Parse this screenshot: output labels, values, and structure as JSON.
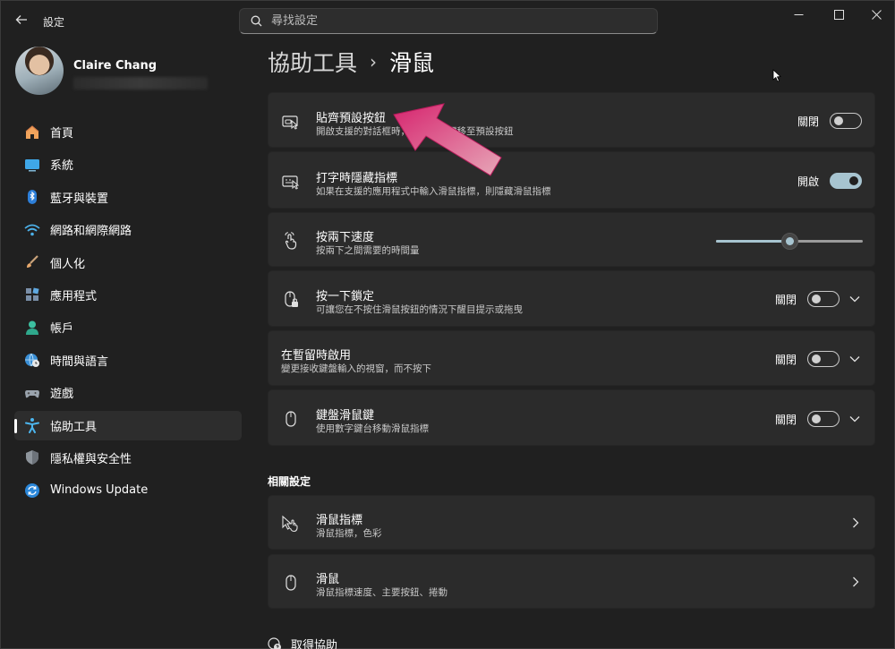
{
  "window": {
    "title": "設定"
  },
  "search": {
    "placeholder": "尋找設定"
  },
  "profile": {
    "name": "Claire Chang"
  },
  "nav": [
    {
      "label": "首頁",
      "icon": "home-icon"
    },
    {
      "label": "系統",
      "icon": "system-icon"
    },
    {
      "label": "藍牙與裝置",
      "icon": "bluetooth-icon"
    },
    {
      "label": "網路和網際網路",
      "icon": "wifi-icon"
    },
    {
      "label": "個人化",
      "icon": "brush-icon"
    },
    {
      "label": "應用程式",
      "icon": "apps-icon"
    },
    {
      "label": "帳戶",
      "icon": "account-icon"
    },
    {
      "label": "時間與語言",
      "icon": "globe-clock-icon"
    },
    {
      "label": "遊戲",
      "icon": "gamepad-icon"
    },
    {
      "label": "協助工具",
      "icon": "accessibility-icon"
    },
    {
      "label": "隱私權與安全性",
      "icon": "shield-icon"
    },
    {
      "label": "Windows Update",
      "icon": "update-icon"
    }
  ],
  "breadcrumb": {
    "parent": "協助工具",
    "separator": "›",
    "current": "滑鼠"
  },
  "settings": {
    "snap": {
      "title": "貼齊預設按鈕",
      "desc": "開啟支援的對話框時，將滑鼠指標移至預設按鈕",
      "state": "關閉"
    },
    "hide_typing": {
      "title": "打字時隱藏指標",
      "desc": "如果在支援的應用程式中輸入滑鼠指標，則隱藏滑鼠指標",
      "state": "開啟"
    },
    "double_click": {
      "title": "按兩下速度",
      "desc": "按兩下之間需要的時間量",
      "value_percent": 50
    },
    "click_lock": {
      "title": "按一下鎖定",
      "desc": "可讓您在不按住滑鼠按鈕的情況下醒目提示或拖曳",
      "state": "關閉"
    },
    "hover_activate": {
      "title": "在暫留時啟用",
      "desc": "變更接收鍵盤輸入的視窗，而不按下",
      "state": "關閉"
    },
    "mouse_keys": {
      "title": "鍵盤滑鼠鍵",
      "desc": "使用數字鍵台移動滑鼠指標",
      "state": "關閉"
    }
  },
  "related": {
    "title": "相關設定",
    "items": [
      {
        "title": "滑鼠指標",
        "desc": "滑鼠指標，色彩"
      },
      {
        "title": "滑鼠",
        "desc": "滑鼠指標速度、主要按鈕、捲動"
      }
    ]
  },
  "help": {
    "label": "取得協助"
  },
  "colors": {
    "accent": "#a7c4d0",
    "annotation_arrow": "#d6246e"
  }
}
